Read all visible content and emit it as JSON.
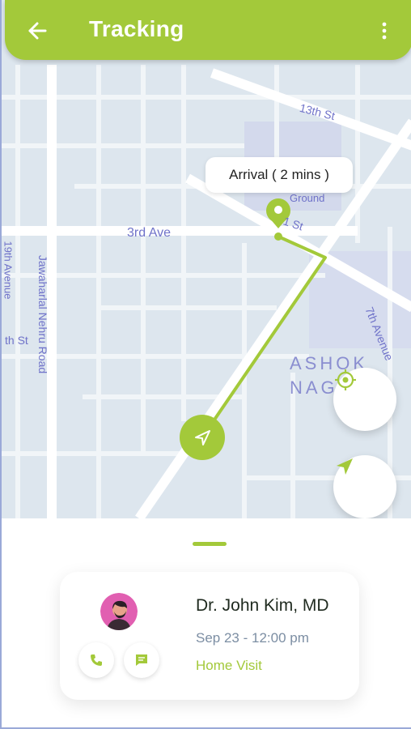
{
  "app": {
    "title": "Tracking",
    "accent_color": "#a3c93a",
    "back_icon": "arrow-left-icon",
    "menu_icon": "more-vertical-icon"
  },
  "map": {
    "eta_label": "Arrival ( 2 mins )",
    "streets": {
      "thirteenth_st": "13th St",
      "ground": "Ground",
      "st_fragment": "1 St",
      "third_ave": "3rd Ave",
      "nineteenth_avenue": "19th Avenue",
      "jawaharlal_nehru_road": "Jawaharlal Nehru Road",
      "th_st": "th St",
      "ashok": "ASHOK",
      "nag": "NAG",
      "seventh_avenue": "7th Avenue"
    },
    "locate_button_icon": "crosshair-icon",
    "navigate_button_icon": "navigation-arrow-icon"
  },
  "appointment": {
    "doctor_name": "Dr. John Kim, MD",
    "datetime": "Sep 23 - 12:00 pm",
    "visit_type": "Home Visit",
    "call_icon": "phone-icon",
    "message_icon": "message-icon"
  }
}
